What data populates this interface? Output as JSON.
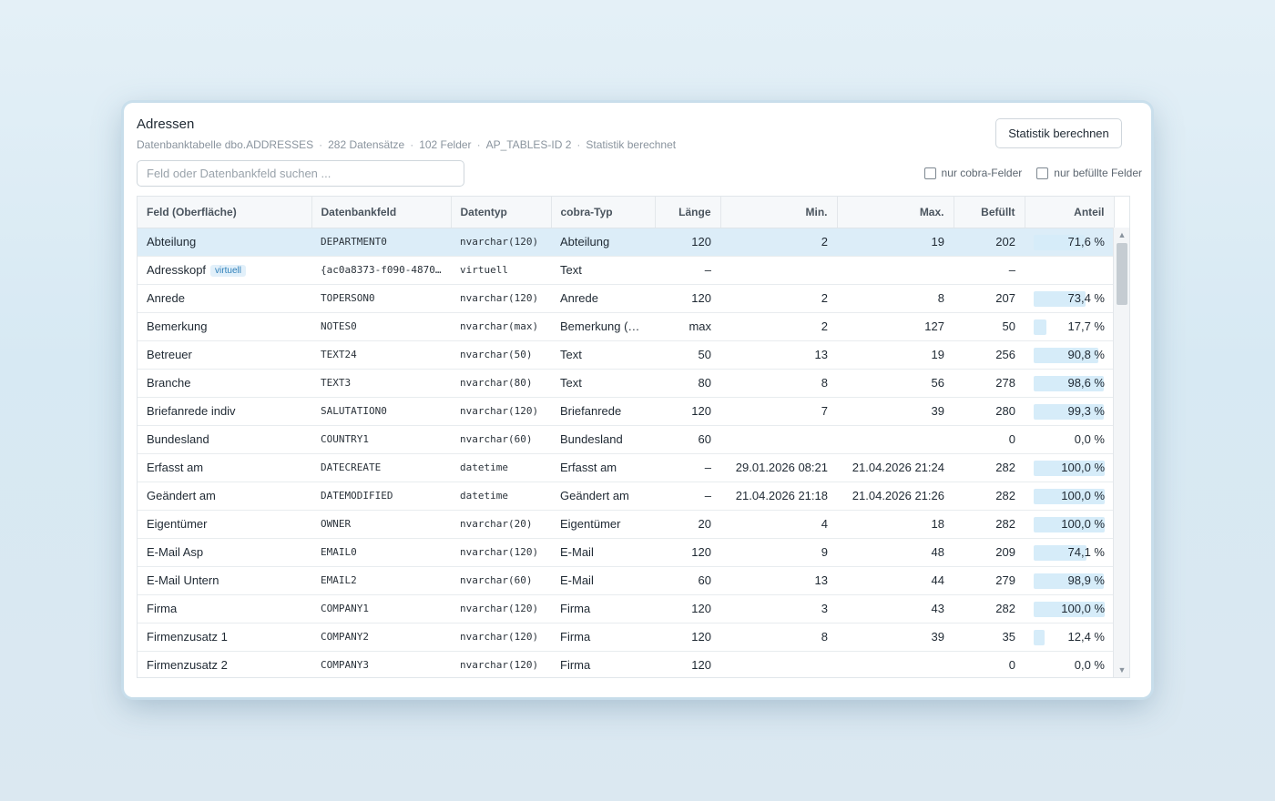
{
  "header": {
    "title": "Adressen",
    "meta": [
      "Datenbanktabelle dbo.ADDRESSES",
      "282 Datensätze",
      "102 Felder",
      "AP_TABLES-ID 2",
      "Statistik berechnet"
    ],
    "calc_button": "Statistik berechnen"
  },
  "search": {
    "placeholder": "Feld oder Datenbankfeld suchen ...",
    "value": ""
  },
  "filters": {
    "cobra_only": "nur cobra-Felder",
    "filled_only": "nur befüllte Felder"
  },
  "colors": {
    "selected_row": "#dcedf8",
    "bar": "#d6ecf9",
    "badge": "#2e7fb8"
  },
  "table": {
    "columns": [
      "Feld (Oberfläche)",
      "Datenbankfeld",
      "Datentyp",
      "cobra-Typ",
      "Länge",
      "Min.",
      "Max.",
      "Befüllt",
      "Anteil"
    ],
    "rows": [
      {
        "field": "Abteilung",
        "badge": "",
        "db": "DEPARTMENT0",
        "type": "nvarchar(120)",
        "cobra": "Abteilung",
        "len": "120",
        "min": "2",
        "max": "19",
        "filled": "202",
        "pct": "71,6 %",
        "frac": 0.716
      },
      {
        "field": "Adresskopf",
        "badge": "virtuell",
        "db": "{ac0a8373-f090-4870…",
        "type": "virtuell",
        "cobra": "Text",
        "len": "–",
        "min": "",
        "max": "",
        "filled": "–",
        "pct": "",
        "frac": 0
      },
      {
        "field": "Anrede",
        "badge": "",
        "db": "TOPERSON0",
        "type": "nvarchar(120)",
        "cobra": "Anrede",
        "len": "120",
        "min": "2",
        "max": "8",
        "filled": "207",
        "pct": "73,4 %",
        "frac": 0.734
      },
      {
        "field": "Bemerkung",
        "badge": "",
        "db": "NOTES0",
        "type": "nvarchar(max)",
        "cobra": "Bemerkung (M…",
        "len": "max",
        "min": "2",
        "max": "127",
        "filled": "50",
        "pct": "17,7 %",
        "frac": 0.177
      },
      {
        "field": "Betreuer",
        "badge": "",
        "db": "TEXT24",
        "type": "nvarchar(50)",
        "cobra": "Text",
        "len": "50",
        "min": "13",
        "max": "19",
        "filled": "256",
        "pct": "90,8 %",
        "frac": 0.908
      },
      {
        "field": "Branche",
        "badge": "",
        "db": "TEXT3",
        "type": "nvarchar(80)",
        "cobra": "Text",
        "len": "80",
        "min": "8",
        "max": "56",
        "filled": "278",
        "pct": "98,6 %",
        "frac": 0.986
      },
      {
        "field": "Briefanrede indiv",
        "badge": "",
        "db": "SALUTATION0",
        "type": "nvarchar(120)",
        "cobra": "Briefanrede",
        "len": "120",
        "min": "7",
        "max": "39",
        "filled": "280",
        "pct": "99,3 %",
        "frac": 0.993
      },
      {
        "field": "Bundesland",
        "badge": "",
        "db": "COUNTRY1",
        "type": "nvarchar(60)",
        "cobra": "Bundesland",
        "len": "60",
        "min": "",
        "max": "",
        "filled": "0",
        "pct": "0,0 %",
        "frac": 0
      },
      {
        "field": "Erfasst am",
        "badge": "",
        "db": "DATECREATE",
        "type": "datetime",
        "cobra": "Erfasst am",
        "len": "–",
        "min": "29.01.2026 08:21",
        "max": "21.04.2026 21:24",
        "filled": "282",
        "pct": "100,0 %",
        "frac": 1.0
      },
      {
        "field": "Geändert am",
        "badge": "",
        "db": "DATEMODIFIED",
        "type": "datetime",
        "cobra": "Geändert am",
        "len": "–",
        "min": "21.04.2026 21:18",
        "max": "21.04.2026 21:26",
        "filled": "282",
        "pct": "100,0 %",
        "frac": 1.0
      },
      {
        "field": "Eigentümer",
        "badge": "",
        "db": "OWNER",
        "type": "nvarchar(20)",
        "cobra": "Eigentümer",
        "len": "20",
        "min": "4",
        "max": "18",
        "filled": "282",
        "pct": "100,0 %",
        "frac": 1.0
      },
      {
        "field": "E-Mail Asp",
        "badge": "",
        "db": "EMAIL0",
        "type": "nvarchar(120)",
        "cobra": "E-Mail",
        "len": "120",
        "min": "9",
        "max": "48",
        "filled": "209",
        "pct": "74,1 %",
        "frac": 0.741
      },
      {
        "field": "E-Mail Untern",
        "badge": "",
        "db": "EMAIL2",
        "type": "nvarchar(60)",
        "cobra": "E-Mail",
        "len": "60",
        "min": "13",
        "max": "44",
        "filled": "279",
        "pct": "98,9 %",
        "frac": 0.989
      },
      {
        "field": "Firma",
        "badge": "",
        "db": "COMPANY1",
        "type": "nvarchar(120)",
        "cobra": "Firma",
        "len": "120",
        "min": "3",
        "max": "43",
        "filled": "282",
        "pct": "100,0 %",
        "frac": 1.0
      },
      {
        "field": "Firmenzusatz 1",
        "badge": "",
        "db": "COMPANY2",
        "type": "nvarchar(120)",
        "cobra": "Firma",
        "len": "120",
        "min": "8",
        "max": "39",
        "filled": "35",
        "pct": "12,4 %",
        "frac": 0.124
      },
      {
        "field": "Firmenzusatz 2",
        "badge": "",
        "db": "COMPANY3",
        "type": "nvarchar(120)",
        "cobra": "Firma",
        "len": "120",
        "min": "",
        "max": "",
        "filled": "0",
        "pct": "0,0 %",
        "frac": 0
      }
    ]
  },
  "scrollbar": {
    "up_icon": "chevron-up-icon",
    "down_icon": "chevron-down-icon"
  }
}
